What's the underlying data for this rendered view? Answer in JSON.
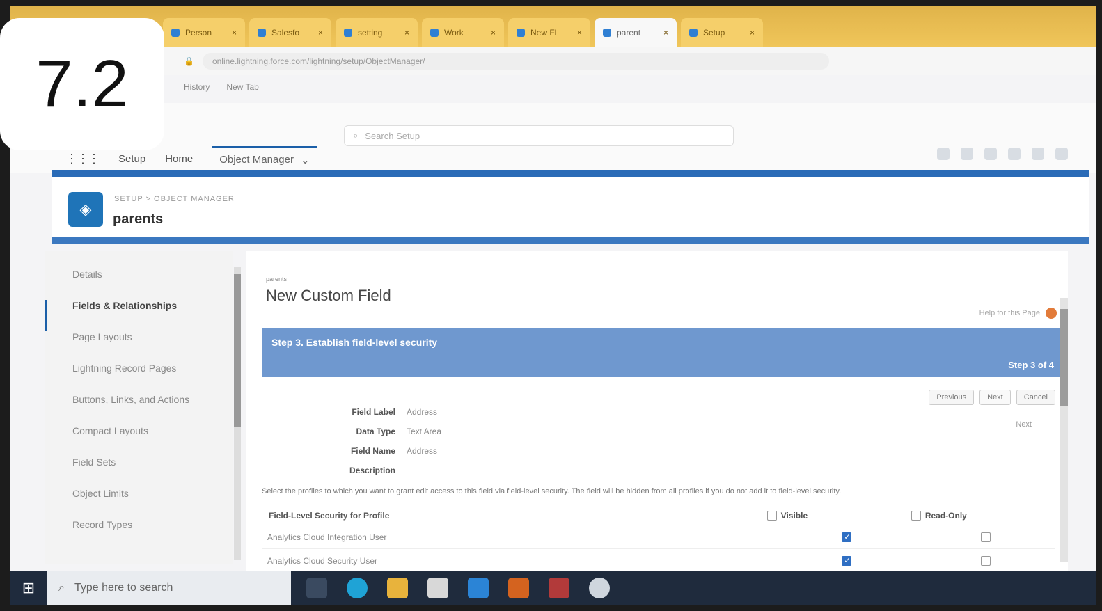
{
  "badge": "7.2",
  "browser": {
    "tabs": [
      {
        "label": "Person",
        "active": false
      },
      {
        "label": "Salesfo",
        "active": false
      },
      {
        "label": "setting",
        "active": false
      },
      {
        "label": "Work",
        "active": false
      },
      {
        "label": "New Fl",
        "active": false
      },
      {
        "label": "parent",
        "active": true
      },
      {
        "label": "Setup",
        "active": false
      }
    ],
    "tab_close": "×",
    "url": "online.lightning.force.com/lightning/setup/ObjectManager/",
    "bookmarks": [
      "History",
      "New Tab"
    ]
  },
  "setup": {
    "search_placeholder": "Search Setup",
    "app_name": "Setup",
    "nav_home": "Home",
    "nav_object_manager": "Object Manager",
    "breadcrumb": "SETUP > OBJECT MANAGER",
    "object_name": "parents"
  },
  "sidebar": {
    "items": [
      {
        "label": "Details",
        "active": false
      },
      {
        "label": "Fields & Relationships",
        "active": true
      },
      {
        "label": "Page Layouts",
        "active": false
      },
      {
        "label": "Lightning Record Pages",
        "active": false
      },
      {
        "label": "Buttons, Links, and Actions",
        "active": false
      },
      {
        "label": "Compact Layouts",
        "active": false
      },
      {
        "label": "Field Sets",
        "active": false
      },
      {
        "label": "Object Limits",
        "active": false
      },
      {
        "label": "Record Types",
        "active": false
      }
    ]
  },
  "main": {
    "kicker": "parents",
    "title": "New Custom Field",
    "help_link": "Help for this Page",
    "step_label": "Step 3. Establish field-level security",
    "step_count": "Step 3 of 4",
    "buttons": {
      "previous": "Previous",
      "next": "Next",
      "cancel": "Cancel"
    },
    "under_button": "Next",
    "fields": [
      {
        "label": "Field Label",
        "value": "Address"
      },
      {
        "label": "Data Type",
        "value": "Text Area"
      },
      {
        "label": "Field Name",
        "value": "Address"
      },
      {
        "label": "Description",
        "value": ""
      }
    ],
    "instructions": "Select the profiles to which you want to grant edit access to this field via field-level security. The field will be hidden from all profiles if you do not add it to field-level security.",
    "fls_header": "Field-Level Security for Profile",
    "col_visible": "Visible",
    "col_readonly": "Read-Only",
    "rows": [
      {
        "profile": "Analytics Cloud Integration User",
        "visible": true,
        "read_only": false
      },
      {
        "profile": "Analytics Cloud Security User",
        "visible": true,
        "read_only": false
      }
    ]
  },
  "taskbar": {
    "search_placeholder": "Type here to search"
  },
  "colors": {
    "brand_blue": "#1b5fa8",
    "step_bar": "#6f98cf",
    "tab_strip": "#f0c65a",
    "taskbar": "#1f2b3d"
  }
}
